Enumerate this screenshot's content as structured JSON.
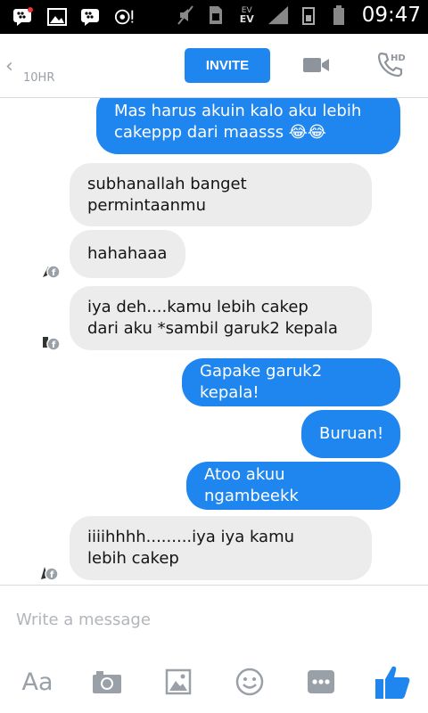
{
  "status_bar": {
    "time": "09:47",
    "network_top": "EV",
    "network_bottom": "EV"
  },
  "header": {
    "back_glyph": "‹",
    "last_active": "10HR",
    "invite_label": "INVITE",
    "call_badge": "HD"
  },
  "messages": [
    {
      "side": "out",
      "text": "Mas harus akuin kalo aku lebih\ncakeppp dari maasss 😂😂"
    },
    {
      "side": "in",
      "text": "subhanallah banget\npermintaanmu"
    },
    {
      "side": "in",
      "text": "hahahaaa"
    },
    {
      "side": "in",
      "text": "iya deh....kamu lebih cakep\ndari aku *sambil garuk2 kepala"
    },
    {
      "side": "out",
      "text": "Gapake garuk2 kepala!"
    },
    {
      "side": "out",
      "text": "Buruan!"
    },
    {
      "side": "out",
      "text": "Atoo akuu ngambeekk"
    },
    {
      "side": "in",
      "text": "iiiihhhh.........iya iya kamu\nlebih cakep"
    }
  ],
  "composer": {
    "placeholder": "Write a message",
    "text_tool": "Aa",
    "icons": [
      "text-icon",
      "camera-icon",
      "gallery-icon",
      "emoji-icon",
      "more-icon",
      "like-icon"
    ]
  },
  "colors": {
    "accent": "#1f86f0",
    "incoming_bubble": "#ececec",
    "icon_grey": "#9aa0a8"
  }
}
